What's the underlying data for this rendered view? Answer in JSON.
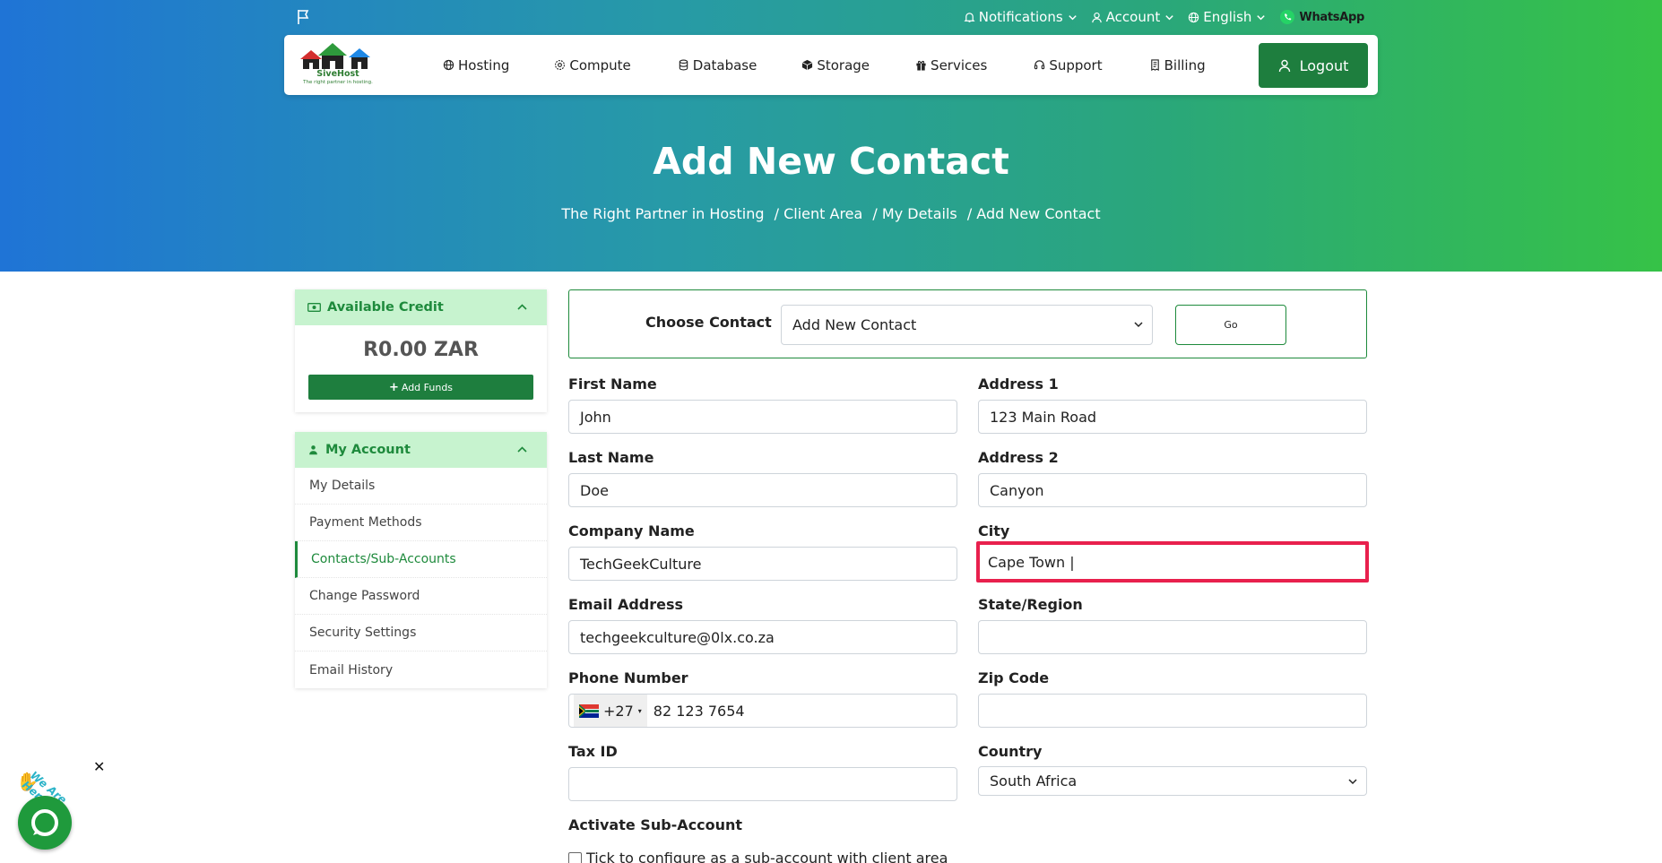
{
  "topbar": {
    "notifications": "Notifications",
    "account": "Account",
    "language": "English",
    "whatsapp": "WhatsApp"
  },
  "logo": {
    "name": "SiveHost",
    "tagline": "The right partner in hosting."
  },
  "nav": {
    "items": [
      {
        "label": "Hosting",
        "icon": "globe-icon"
      },
      {
        "label": "Compute",
        "icon": "gear-icon"
      },
      {
        "label": "Database",
        "icon": "database-icon"
      },
      {
        "label": "Storage",
        "icon": "box-icon"
      },
      {
        "label": "Services",
        "icon": "gift-icon"
      },
      {
        "label": "Support",
        "icon": "headset-icon"
      },
      {
        "label": "Billing",
        "icon": "invoice-icon"
      }
    ],
    "logout": "Logout"
  },
  "page": {
    "title": "Add New Contact",
    "breadcrumb": [
      "The Right Partner in Hosting",
      "/ Client Area",
      "/ My Details",
      "/ Add New Contact"
    ]
  },
  "sidebar": {
    "credit": {
      "title": "Available Credit",
      "amount": "R0.00 ZAR",
      "add_funds": "Add Funds"
    },
    "account": {
      "title": "My Account",
      "items": [
        "My Details",
        "Payment Methods",
        "Contacts/Sub-Accounts",
        "Change Password",
        "Security Settings",
        "Email History"
      ],
      "active": "Contacts/Sub-Accounts"
    }
  },
  "choose_contact": {
    "label": "Choose Contact",
    "selected": "Add New Contact",
    "go": "Go"
  },
  "form": {
    "first_name": {
      "label": "First Name",
      "value": "John"
    },
    "last_name": {
      "label": "Last Name",
      "value": "Doe"
    },
    "company_name": {
      "label": "Company Name",
      "value": "TechGeekCulture"
    },
    "email": {
      "label": "Email Address",
      "value": "techgeekculture@0lx.co.za"
    },
    "phone": {
      "label": "Phone Number",
      "dial_code": "+27",
      "value": "82 123 7654"
    },
    "tax_id": {
      "label": "Tax ID",
      "value": ""
    },
    "address1": {
      "label": "Address 1",
      "value": "123 Main Road"
    },
    "address2": {
      "label": "Address 2",
      "value": "Canyon"
    },
    "city": {
      "label": "City",
      "value": "Cape Town |"
    },
    "state": {
      "label": "State/Region",
      "value": ""
    },
    "zip": {
      "label": "Zip Code",
      "value": ""
    },
    "country": {
      "label": "Country",
      "value": "South Africa"
    },
    "activate": {
      "label": "Activate Sub-Account",
      "checkbox_label": "Tick to configure as a sub-account with client area"
    }
  },
  "chat": {
    "text": "We Are Here!",
    "close": "✕"
  },
  "colors": {
    "primary_green": "#1e7e3e",
    "focus_red": "#e8204d",
    "panel_header": "#c7f3cf"
  }
}
